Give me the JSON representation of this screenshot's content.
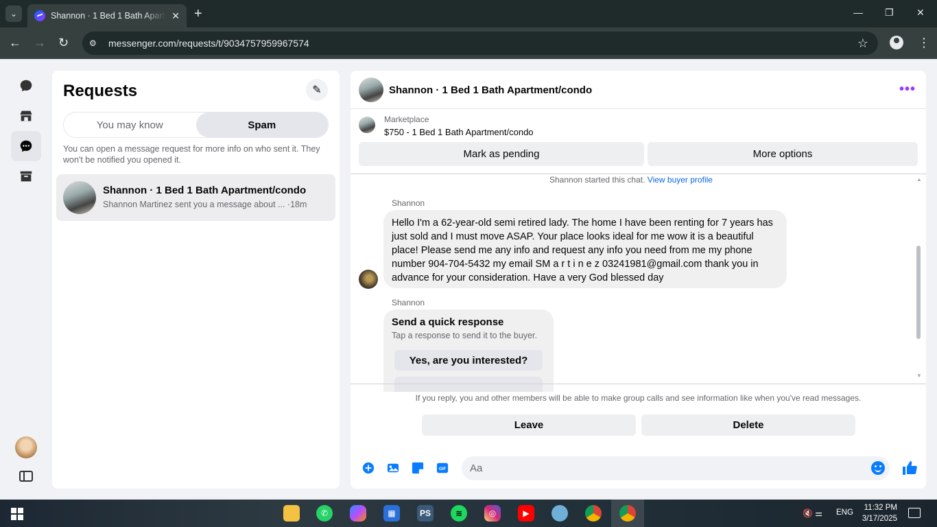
{
  "browser": {
    "tab_title": "Shannon · 1 Bed 1 Bath Apartm",
    "url": "messenger.com/requests/t/9034757959967574"
  },
  "requests": {
    "title": "Requests",
    "tabs": [
      {
        "label": "You may know",
        "active": false
      },
      {
        "label": "Spam",
        "active": true
      }
    ],
    "info": "You can open a message request for more info on who sent it. They won't be notified you opened it.",
    "thread": {
      "name": "Shannon · 1 Bed 1 Bath Apartment/condo",
      "preview": "Shannon Martinez sent you a message about ... ·18m"
    }
  },
  "chat": {
    "header_name": "Shannon · 1 Bed 1 Bath Apartment/condo",
    "marketplace_label": "Marketplace",
    "listing": "$750 - 1 Bed 1 Bath Apartment/condo",
    "mark_pending": "Mark as pending",
    "more_options": "More options",
    "started": "Shannon started this chat.",
    "view_profile": "View buyer profile",
    "sender1": "Shannon",
    "message": "Hello I'm a 62-year-old semi retired lady. The home I have been renting for 7 years has just sold and I must move ASAP. Your place looks ideal for me wow it is a beautiful place! Please send me any info and request any info you need from me my phone number 904-704-5432 my email SM a r t i n e z 03241981@gmail.com thank you in advance for your consideration. Have a very God blessed day",
    "sender2": "Shannon",
    "quick_title": "Send a quick response",
    "quick_sub": "Tap a response to send it to the buyer.",
    "quick_option1": "Yes, are you interested?",
    "reply_note": "If you reply, you and other members will be able to make group calls and see information like when you've read messages.",
    "leave": "Leave",
    "delete": "Delete",
    "composer_placeholder": "Aa"
  },
  "taskbar": {
    "lang": "ENG",
    "time": "11:32 PM",
    "date": "3/17/2025"
  },
  "colors": {
    "accent": "#0a7cff",
    "more_icon": "#9b36ff"
  }
}
